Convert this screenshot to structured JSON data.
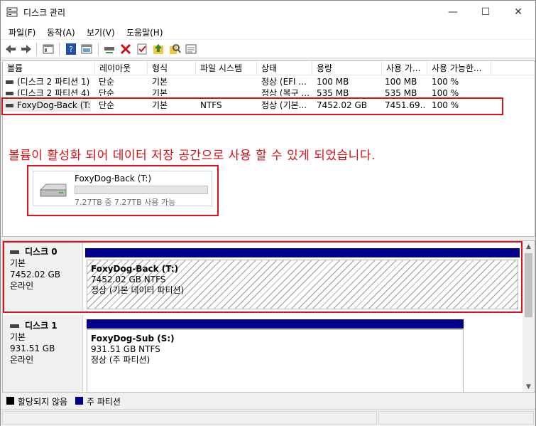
{
  "window": {
    "title": "디스크 관리"
  },
  "menu": [
    "파일(F)",
    "동작(A)",
    "보기(V)",
    "도움말(H)"
  ],
  "toolbar": [
    "back-icon",
    "forward-icon",
    "properties-icon",
    "help-icon",
    "view-icon",
    "connect-icon",
    "delete-icon",
    "check-icon",
    "up-icon",
    "search-icon",
    "list-icon"
  ],
  "columns": [
    "볼륨",
    "레이아웃",
    "형식",
    "파일 시스템",
    "상태",
    "용량",
    "사용 가...",
    "사용 가능한..."
  ],
  "volumes": [
    {
      "name": "(디스크 2 파티션 1)",
      "layout": "단순",
      "type": "기본",
      "fs": "",
      "status": "정상 (EFI ...",
      "capacity": "100 MB",
      "free": "100 MB",
      "pct": "100 %"
    },
    {
      "name": "(디스크 2 파티션 4)",
      "layout": "단순",
      "type": "기본",
      "fs": "",
      "status": "정상 (복구 ...",
      "capacity": "535 MB",
      "free": "535 MB",
      "pct": "100 %"
    },
    {
      "name": "FoxyDog-Back (T:)",
      "layout": "단순",
      "type": "기본",
      "fs": "NTFS",
      "status": "정상 (기본...",
      "capacity": "7452.02 GB",
      "free": "7451.69...",
      "pct": "100 %"
    }
  ],
  "annotation": "볼륨이 활성화 되어 데이터 저장 공간으로 사용 할 수 있게 되었습니다.",
  "volume_card": {
    "name": "FoxyDog-Back (T:)",
    "detail": "7.27TB 중 7.27TB 사용 가능",
    "used_fraction": 0.0
  },
  "disks": [
    {
      "title": "디스크 0",
      "kind": "기본",
      "size": "7452.02 GB",
      "state": "온라인",
      "partition": {
        "name": "FoxyDog-Back  (T:)",
        "size": "7452.02 GB NTFS",
        "status": "정상 (기본 데이터 파티션)"
      }
    },
    {
      "title": "디스크 1",
      "kind": "기본",
      "size": "931.51 GB",
      "state": "온라인",
      "partition": {
        "name": "FoxyDog-Sub  (S:)",
        "size": "931.51 GB NTFS",
        "status": "정상 (주 파티션)"
      }
    }
  ],
  "legend": [
    {
      "label": "할당되지 않음",
      "color": "#000000"
    },
    {
      "label": "주 파티션",
      "color": "#00008b"
    }
  ],
  "colors": {
    "accent_red": "#e0101a",
    "partition_header": "#00008b"
  }
}
